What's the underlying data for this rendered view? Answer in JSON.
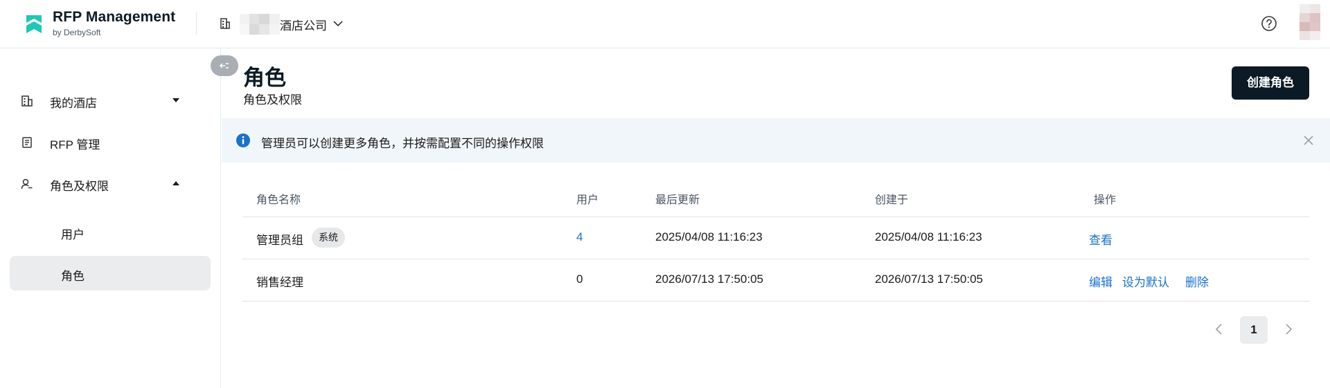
{
  "app": {
    "title": "RFP Management",
    "subtitle": "by DerbySoft"
  },
  "org": {
    "name": "酒店公司"
  },
  "sidebar": {
    "items": [
      {
        "label": "我的酒店"
      },
      {
        "label": "RFP 管理"
      },
      {
        "label": "角色及权限"
      }
    ],
    "subitems": [
      {
        "label": "用户"
      },
      {
        "label": "角色"
      }
    ]
  },
  "page": {
    "title": "角色",
    "subtitle": "角色及权限",
    "create_label": "创建角色"
  },
  "banner": {
    "text": "管理员可以创建更多角色，并按需配置不同的操作权限"
  },
  "table": {
    "headers": {
      "name": "角色名称",
      "users": "用户",
      "updated": "最后更新",
      "created": "创建于",
      "actions": "操作"
    },
    "rows": [
      {
        "name": "管理员组",
        "badge": "系统",
        "users": "4",
        "updated": "2025/04/08 11:16:23",
        "created": "2025/04/08 11:16:23",
        "actions": [
          "查看"
        ]
      },
      {
        "name": "销售经理",
        "users": "0",
        "updated": "2026/07/13 17:50:05",
        "created": "2026/07/13 17:50:05",
        "actions": [
          "编辑",
          "设为默认",
          "删除"
        ]
      }
    ]
  },
  "pagination": {
    "current": "1"
  },
  "colors": {
    "accent": "#1a73c8",
    "brand": "#1ec8b4",
    "primary_button": "#0b1a24",
    "active_bg": "#ebecee",
    "banner_bg": "#f1f6fa"
  }
}
